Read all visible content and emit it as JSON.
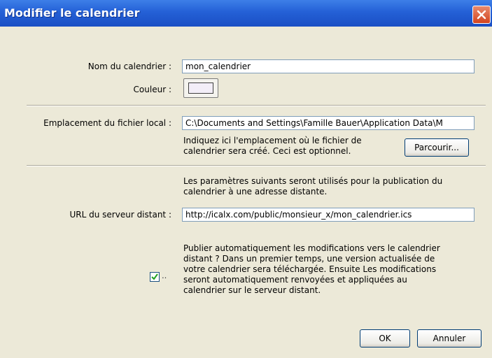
{
  "window": {
    "title": "Modifier le calendrier"
  },
  "calendar_name": {
    "label": "Nom du calendrier :",
    "value": "mon_calendrier"
  },
  "color": {
    "label": "Couleur :",
    "swatch": "#f3eef8"
  },
  "local_file": {
    "label": "Emplacement du fichier local :",
    "value": "C:\\Documents and Settings\\Famille Bauer\\Application Data\\M",
    "help_line1": "Indiquez ici l'emplacement où le fichier de",
    "help_line2": "calendrier sera créé. Ceci est optionnel.",
    "browse_label": "Parcourir..."
  },
  "remote": {
    "info_line1": "Les paramètres suivants seront utilisés pour la publication du",
    "info_line2": "calendrier à une adresse distante.",
    "url_label": "URL du serveur distant :",
    "url_value": "http://icalx.com/public/monsieur_x/mon_calendrier.ics",
    "auto_publish_checked": true,
    "auto_publish_lines": [
      "Publier automatiquement les modifications vers le calendrier",
      "distant ? Dans un premier temps, une version actualisée de",
      "votre calendrier sera téléchargée. Ensuite Les modifications",
      "seront automatiquement renvoyées et appliquées au",
      "calendrier sur le serveur distant."
    ]
  },
  "buttons": {
    "ok": "OK",
    "cancel": "Annuler"
  }
}
